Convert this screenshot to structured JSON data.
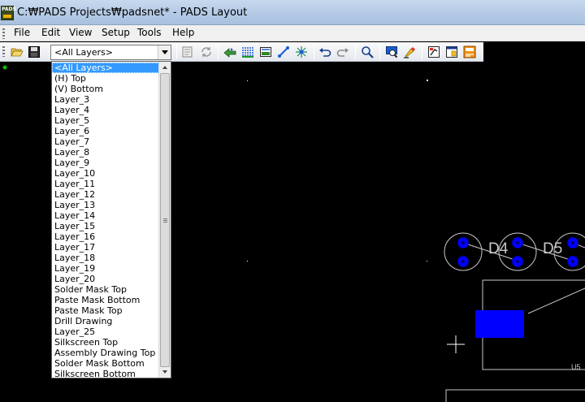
{
  "window": {
    "title": "C:₩PADS Projects₩padsnet* - PADS Layout",
    "icon_text": "PADS"
  },
  "menu": {
    "items": [
      {
        "label": "File"
      },
      {
        "label": "Edit"
      },
      {
        "label": "View"
      },
      {
        "label": "Setup"
      },
      {
        "label": "Tools"
      },
      {
        "label": "Help"
      }
    ]
  },
  "toolbar": {
    "layer_selector_value": "<All Layers>",
    "icons": [
      "open-icon",
      "save-icon",
      "properties-icon",
      "refresh-icon",
      "route-icon",
      "pour-icon",
      "plane-icon",
      "sketch-icon",
      "cluster-icon",
      "undo-icon",
      "redo-icon",
      "zoom-icon",
      "view-nets-icon",
      "highlight-icon",
      "display-colors-icon",
      "window-icon",
      "pads-router-icon"
    ]
  },
  "layer_dropdown": {
    "items": [
      "<All Layers>",
      "(H) Top",
      "(V) Bottom",
      "Layer_3",
      "Layer_4",
      "Layer_5",
      "Layer_6",
      "Layer_7",
      "Layer_8",
      "Layer_9",
      "Layer_10",
      "Layer_11",
      "Layer_12",
      "Layer_13",
      "Layer_14",
      "Layer_15",
      "Layer_16",
      "Layer_17",
      "Layer_18",
      "Layer_19",
      "Layer_20",
      "Solder Mask Top",
      "Paste Mask Bottom",
      "Paste Mask Top",
      "Drill Drawing",
      "Layer_25",
      "Silkscreen Top",
      "Assembly Drawing Top",
      "Solder Mask Bottom",
      "Silkscreen Bottom"
    ],
    "selected_index": 0
  },
  "canvas": {
    "background": "#000000",
    "pad_color": "#0000ff",
    "outline_color": "#c8c8c8",
    "labels": {
      "d4": "D4",
      "d5": "D5",
      "u5": "U5"
    }
  }
}
